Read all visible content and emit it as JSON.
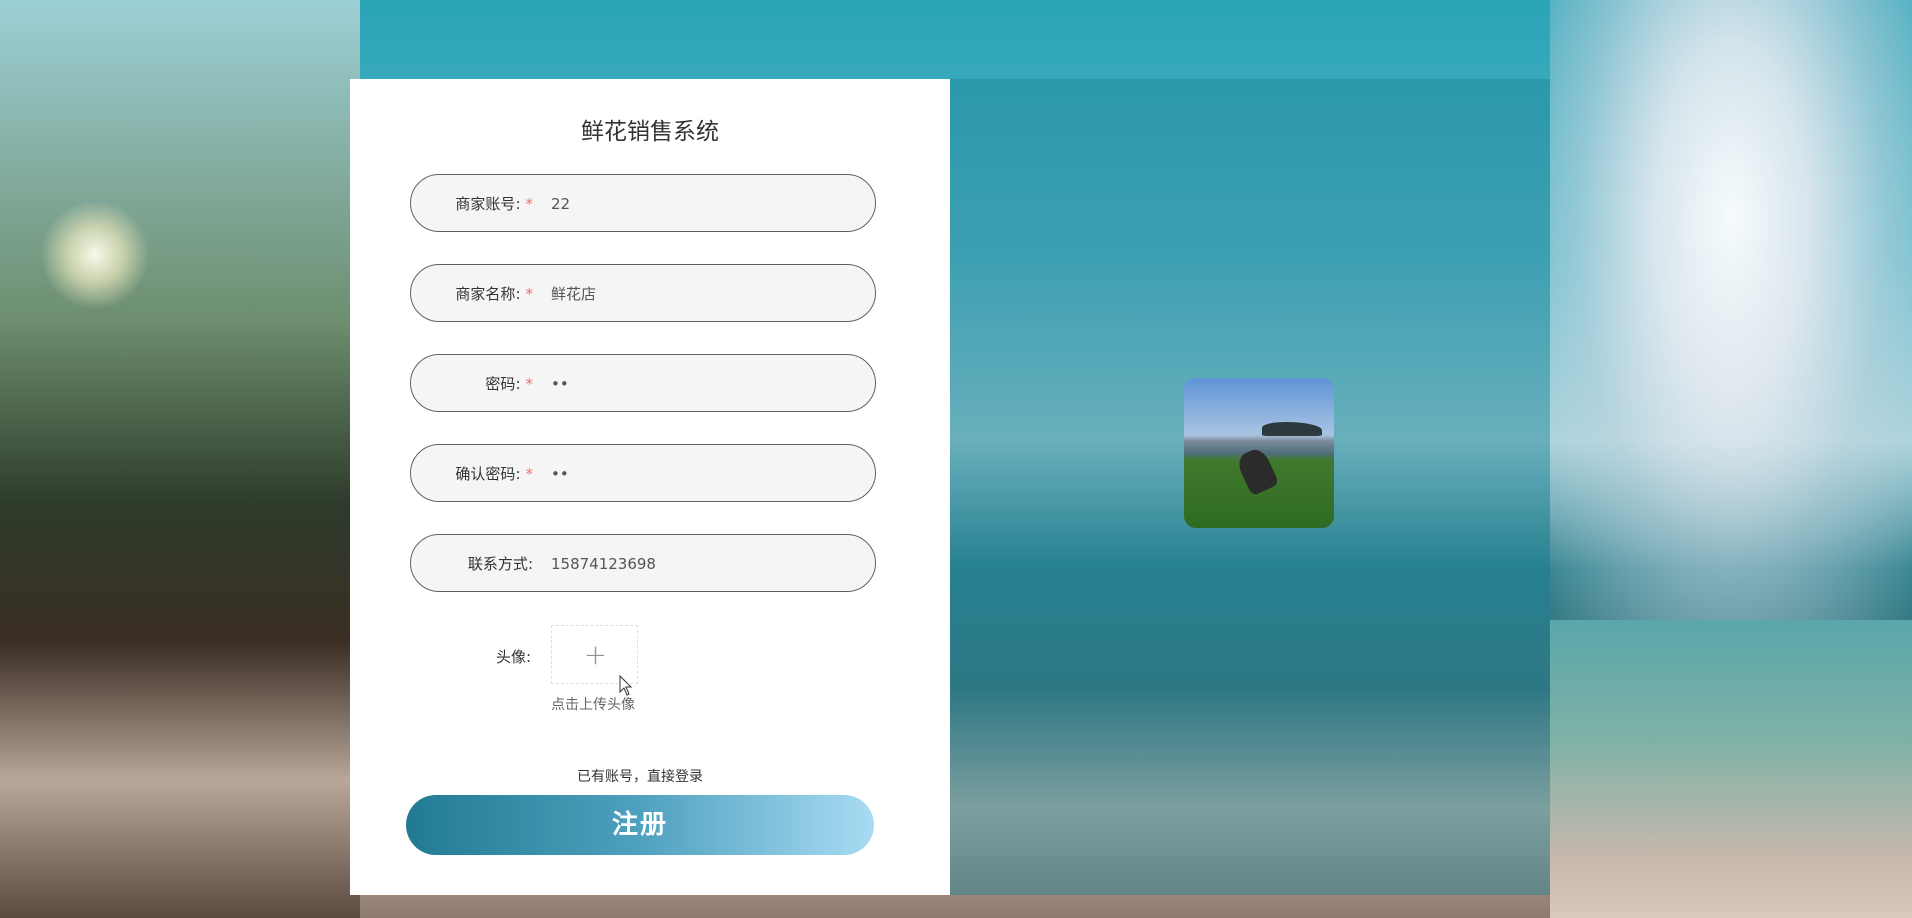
{
  "app": {
    "title": "鲜花销售系统"
  },
  "form": {
    "fields": [
      {
        "label": "商家账号",
        "required": true,
        "value": "22"
      },
      {
        "label": "商家名称",
        "required": true,
        "value": "鲜花店"
      },
      {
        "label": "密码",
        "required": true,
        "value": "••"
      },
      {
        "label": "确认密码",
        "required": true,
        "value": "••"
      },
      {
        "label": "联系方式",
        "required": false,
        "value": "15874123698"
      }
    ],
    "colon": ":",
    "required_mark": "*",
    "avatar": {
      "label": "头像:",
      "plus": "+",
      "hint": "点击上传头像"
    },
    "login_link": "已有账号，直接登录",
    "register_button": "注册"
  },
  "colors": {
    "button_gradient_start": "#217a92",
    "button_gradient_end": "#a9dbf3",
    "required": "#f56c6c",
    "field_border": "#606266"
  },
  "icons": {
    "upload": "plus-icon",
    "cursor": "mouse-pointer-icon"
  }
}
